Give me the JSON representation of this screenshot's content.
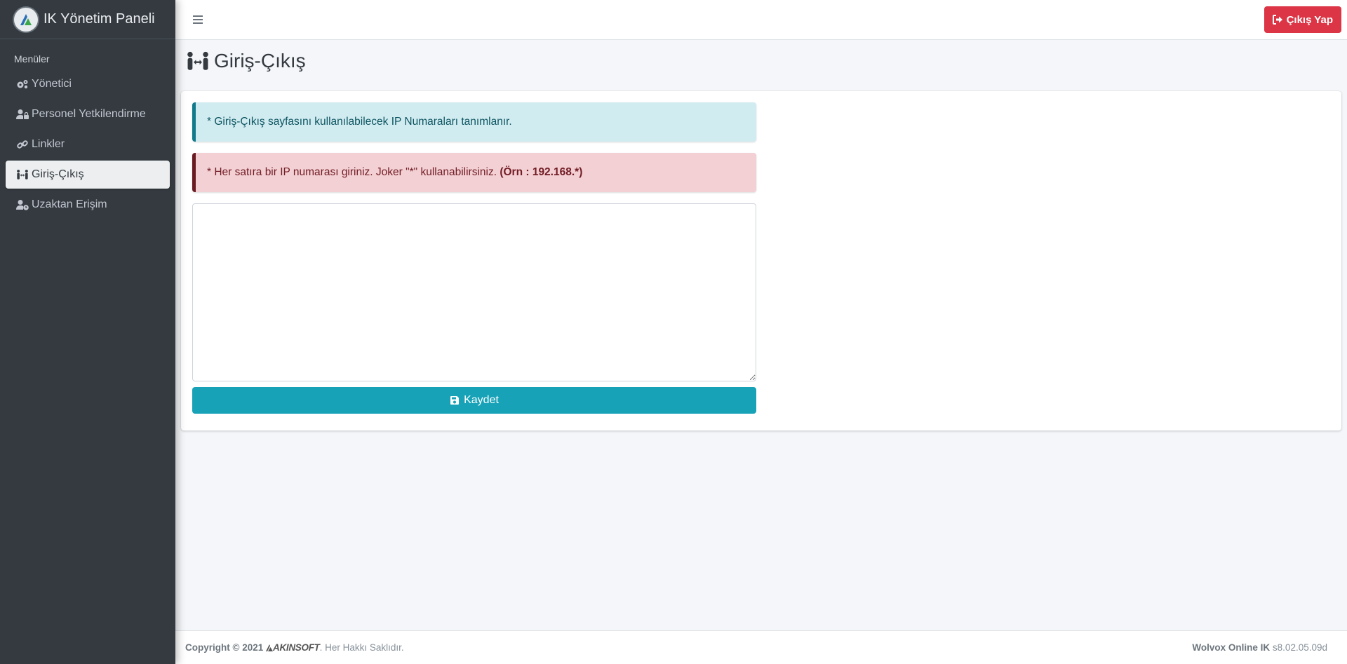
{
  "brand": {
    "title": "IK Yönetim Paneli"
  },
  "sidebar": {
    "header": "Menüler",
    "items": [
      {
        "label": "Yönetici",
        "icon": "cogs-icon",
        "active": false
      },
      {
        "label": "Personel Yetkilendirme",
        "icon": "user-lock-icon",
        "active": false
      },
      {
        "label": "Linkler",
        "icon": "link-icon",
        "active": false
      },
      {
        "label": "Giriş-Çıkış",
        "icon": "people-arrows-icon",
        "active": true
      },
      {
        "label": "Uzaktan Erişim",
        "icon": "user-clock-icon",
        "active": false
      }
    ]
  },
  "topbar": {
    "logout_label": "Çıkış Yap"
  },
  "page": {
    "title": "Giriş-Çıkış",
    "info_alert": "* Giriş-Çıkış sayfasını kullanılabilecek IP Numaraları tanımlanır.",
    "danger_alert": "* Her satıra bir IP numarası giriniz. Joker \"*\" kullanabilirsiniz.",
    "danger_alert_bold": "(Örn : 192.168.*)",
    "ip_textarea_value": "",
    "save_label": "Kaydet"
  },
  "footer": {
    "copyright": "Copyright © 2021",
    "company": "AKINSOFT",
    "rights": ". Her Hakkı Saklıdır.",
    "product": "Wolvox Online IK",
    "version": "s8.02.05.09d"
  },
  "colors": {
    "sidebar_bg": "#343a40",
    "danger": "#dc3545",
    "info": "#17a2b8"
  }
}
